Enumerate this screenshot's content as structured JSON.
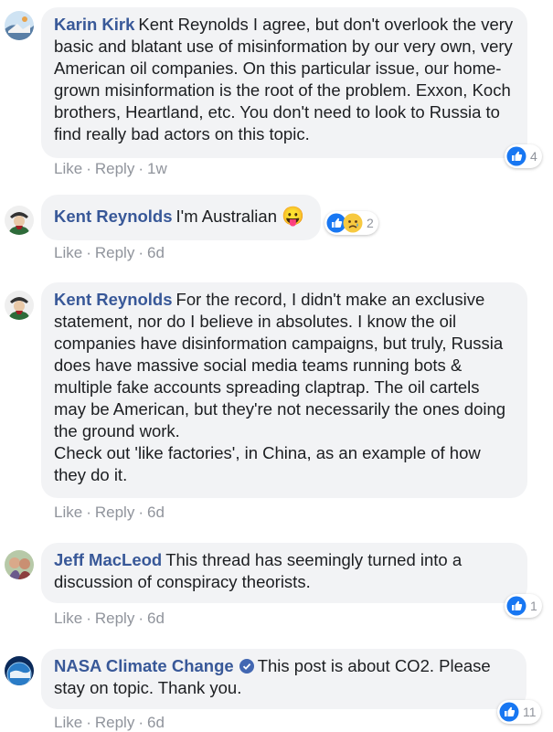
{
  "comments": [
    {
      "author": "Karin Kirk",
      "text": "Kent Reynolds I agree, but don't overlook the very basic and blatant use of misinformation by our very own, very American oil companies. On this particular issue, our home-grown misinformation is the root of the problem. Exxon, Koch brothers, Heartland, etc. You don't need to look to Russia to find really bad actors on this topic.",
      "reaction_count": "4",
      "like": "Like",
      "reply": "Reply",
      "time": "1w"
    },
    {
      "author": "Kent Reynolds",
      "text": "I'm Australian",
      "emoji": "😛",
      "reaction_count": "2",
      "like": "Like",
      "reply": "Reply",
      "time": "6d"
    },
    {
      "author": "Kent Reynolds",
      "text": "For the record, I didn't make an exclusive statement, nor do I believe in absolutes. I know the oil companies have disinformation campaigns, but truly, Russia does have massive social media teams running bots & multiple fake accounts spreading claptrap. The oil cartels may be American, but they're not necessarily the ones doing the ground work.\nCheck out 'like factories', in China, as an example of how they do it.",
      "like": "Like",
      "reply": "Reply",
      "time": "6d"
    },
    {
      "author": "Jeff MacLeod",
      "text": "This thread has seemingly turned into a discussion of conspiracy theorists.",
      "reaction_count": "1",
      "like": "Like",
      "reply": "Reply",
      "time": "6d"
    },
    {
      "author": "NASA Climate Change",
      "text": "This post is about CO2. Please stay on topic. Thank you.",
      "reaction_count": "11",
      "like": "Like",
      "reply": "Reply",
      "time": "6d"
    }
  ],
  "separator": "·",
  "colors": {
    "author": "#385898",
    "bubble": "#f2f3f5",
    "meta": "#90949c",
    "like_blue": "#1877f2",
    "verified": "#4267b2"
  },
  "icons": [
    "like-reaction-icon",
    "sad-reaction-icon",
    "verified-badge-icon"
  ]
}
